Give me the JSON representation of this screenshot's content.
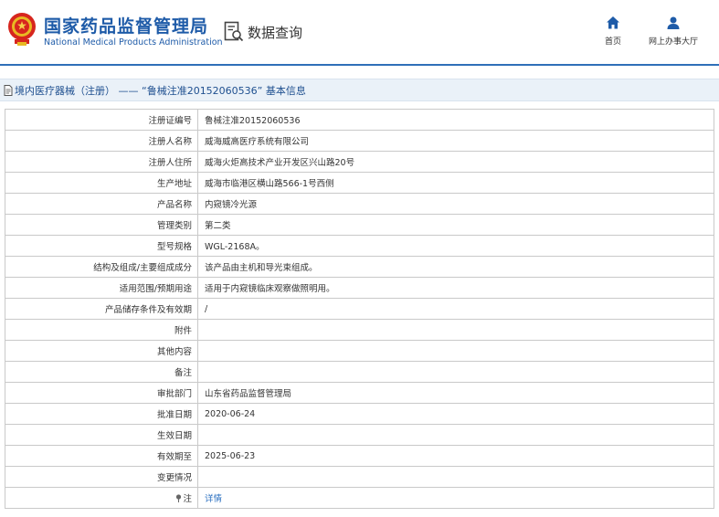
{
  "header": {
    "org_name_cn": "国家药品监督管理局",
    "org_name_en": "National Medical Products Administration",
    "query_label": "数据查询",
    "nav": [
      {
        "label": "首页",
        "icon": "home-icon"
      },
      {
        "label": "网上办事大厅",
        "icon": "user-icon"
      }
    ]
  },
  "title_bar": {
    "text": "境内医疗器械（注册） —— “鲁械注准20152060536” 基本信息"
  },
  "rows": [
    {
      "label": "注册证编号",
      "value": "鲁械注准20152060536"
    },
    {
      "label": "注册人名称",
      "value": "威海威高医疗系统有限公司"
    },
    {
      "label": "注册人住所",
      "value": "威海火炬高技术产业开发区兴山路20号"
    },
    {
      "label": "生产地址",
      "value": "威海市临港区横山路566-1号西侧"
    },
    {
      "label": "产品名称",
      "value": "内窥镜冷光源"
    },
    {
      "label": "管理类别",
      "value": "第二类"
    },
    {
      "label": "型号规格",
      "value": "WGL-2168A。"
    },
    {
      "label": "结构及组成/主要组成成分",
      "value": "该产品由主机和导光束组成。"
    },
    {
      "label": "适用范围/预期用途",
      "value": "适用于内窥镜临床观察做照明用。"
    },
    {
      "label": "产品储存条件及有效期",
      "value": "/"
    },
    {
      "label": "附件",
      "value": ""
    },
    {
      "label": "其他内容",
      "value": ""
    },
    {
      "label": "备注",
      "value": ""
    },
    {
      "label": "审批部门",
      "value": "山东省药品监督管理局"
    },
    {
      "label": "批准日期",
      "value": "2020-06-24"
    },
    {
      "label": "生效日期",
      "value": ""
    },
    {
      "label": "有效期至",
      "value": "2025-06-23"
    },
    {
      "label": "变更情况",
      "value": ""
    },
    {
      "label": "注",
      "value": "详情"
    }
  ],
  "colors": {
    "brand_blue": "#1e5ba8",
    "link_blue": "#2a6fc0",
    "title_bar_bg": "#eaf1f8"
  }
}
